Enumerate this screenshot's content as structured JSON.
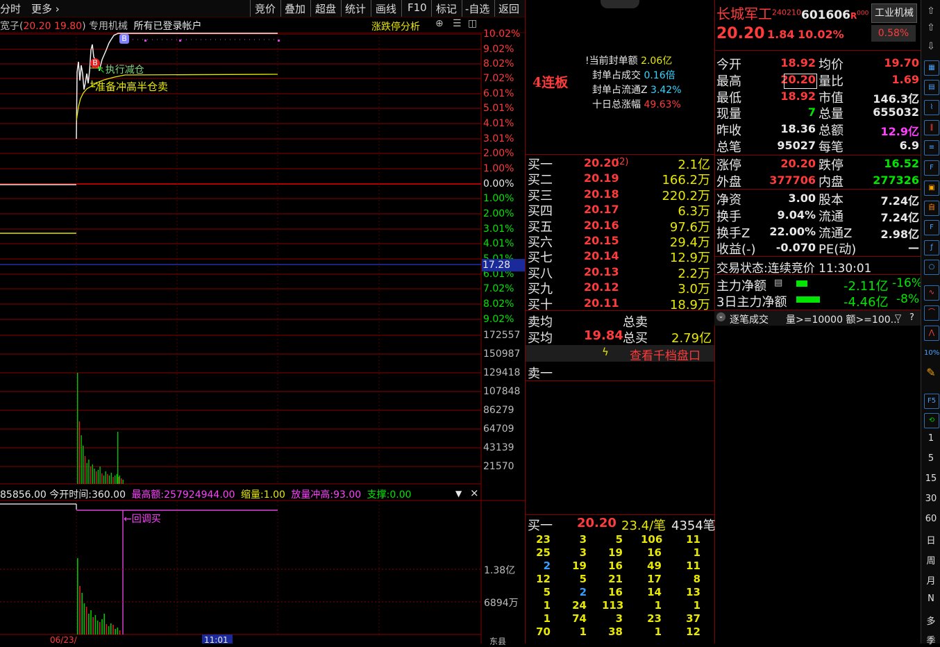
{
  "toolbar": {
    "left_tab": "分时",
    "more": "更多",
    "buttons": [
      "竞价",
      "叠加",
      "超盘",
      "统计",
      "画线",
      "F10",
      "标记",
      "-自选",
      "返回"
    ]
  },
  "chart_header": {
    "name_prefix": "宽子(",
    "prices": "20.20 19.80",
    "name_suffix": ") 专用机械",
    "account": "所有已登录帐户",
    "analysis_link": "涨跌停分析"
  },
  "price_axis": {
    "upper": [
      "10.02%",
      "9.02%",
      "8.02%",
      "7.02%",
      "6.01%",
      "5.01%",
      "4.01%",
      "3.01%",
      "2.00%",
      "1.00%"
    ],
    "zero": "0.00%",
    "lower": [
      "1.00%",
      "2.00%",
      "3.01%",
      "4.01%",
      "5.01%",
      "6.01%",
      "7.02%",
      "8.02%",
      "9.02%"
    ],
    "cursor_price": "17.28"
  },
  "volume_axis": [
    "172557",
    "150987",
    "129418",
    "107848",
    "86279",
    "64709",
    "43139",
    "21570"
  ],
  "annotations": {
    "sell_note": "执行减仓",
    "plan_note": "准备冲高半仓卖",
    "marker_b": "B",
    "marker_b2": "B",
    "callback_buy": "←回调买"
  },
  "indicator_bar": {
    "lead_value": "85856.00",
    "open_time_label": "今开时间:",
    "open_time_value": "360.00",
    "max_amount_label": "最高额:",
    "max_amount_value": "257924944.00",
    "shrink_label": "缩量:",
    "shrink_value": "1.00",
    "surge_label": "放量冲高:",
    "surge_value": "93.00",
    "support_label": "支撑:",
    "support_value": "0.00",
    "close_icon": "×"
  },
  "amount_axis": [
    "1.38亿",
    "6894万"
  ],
  "time_axis": {
    "date": "06/23/",
    "cursor_time": "11:01",
    "right_label": "东县"
  },
  "board": {
    "limit_label": "4连板",
    "current_seal_label": "当前封单额",
    "current_seal_value": "2.06亿",
    "seal_ratio_label": "封单占成交",
    "seal_ratio_value": "0.16倍",
    "seal_float_label": "封单占流通Z",
    "seal_float_value": "3.42%",
    "ten_day_label": "十日总涨幅",
    "ten_day_value": "49.63%"
  },
  "bids": [
    {
      "label": "买一",
      "price": "20.20",
      "extra": "(2)",
      "vol": "2.1亿"
    },
    {
      "label": "买二",
      "price": "20.19",
      "extra": "",
      "vol": "166.2万"
    },
    {
      "label": "买三",
      "price": "20.18",
      "extra": "",
      "vol": "220.2万"
    },
    {
      "label": "买四",
      "price": "20.17",
      "extra": "",
      "vol": "6.3万"
    },
    {
      "label": "买五",
      "price": "20.16",
      "extra": "",
      "vol": "97.6万"
    },
    {
      "label": "买六",
      "price": "20.15",
      "extra": "",
      "vol": "29.4万"
    },
    {
      "label": "买七",
      "price": "20.14",
      "extra": "",
      "vol": "12.9万"
    },
    {
      "label": "买八",
      "price": "20.13",
      "extra": "",
      "vol": "2.2万"
    },
    {
      "label": "买九",
      "price": "20.12",
      "extra": "",
      "vol": "3.0万"
    },
    {
      "label": "买十",
      "price": "20.11",
      "extra": "",
      "vol": "18.9万"
    }
  ],
  "avg": {
    "sell_avg_label": "卖均",
    "total_sell_label": "总卖",
    "buy_avg_label": "买均",
    "buy_avg_value": "19.84",
    "total_buy_label": "总买",
    "total_buy_value": "2.79亿"
  },
  "depth_link": "查看千档盘口",
  "sell_one": "卖一",
  "queue": {
    "label": "买一",
    "price": "20.20",
    "avg": "23.4/笔",
    "count": "4354笔",
    "rows": [
      [
        "23",
        "3",
        "5",
        "106",
        "11"
      ],
      [
        "25",
        "3",
        "19",
        "16",
        "1"
      ],
      [
        "2",
        "19",
        "16",
        "49",
        "11"
      ],
      [
        "12",
        "5",
        "21",
        "17",
        "8"
      ],
      [
        "5",
        "2",
        "16",
        "14",
        "13"
      ],
      [
        "1",
        "24",
        "113",
        "1",
        "1"
      ],
      [
        "1",
        "74",
        "3",
        "23",
        "37"
      ],
      [
        "70",
        "1",
        "38",
        "1",
        "12"
      ]
    ]
  },
  "stock": {
    "name": "长城军工",
    "sup": "240210",
    "code": "601606",
    "r_tag": "R",
    "r_sup": "000",
    "industry": "工业机械",
    "price": "20.20",
    "change": "1.84",
    "pct": "10.02%",
    "industry_pct": "0.58%"
  },
  "stats": [
    {
      "l": "今开",
      "v": "18.92",
      "l2": "均价",
      "v2": "19.70"
    },
    {
      "l": "最高",
      "v": "20.20",
      "l2": "量比",
      "v2": "1.69"
    },
    {
      "l": "最低",
      "v": "18.92",
      "l2": "市值",
      "v2": "146.3亿"
    },
    {
      "l": "现量",
      "v": "7",
      "l2": "总量",
      "v2": "655032"
    },
    {
      "l": "昨收",
      "v": "18.36",
      "l2": "总额",
      "v2": "12.9亿"
    },
    {
      "l": "总笔",
      "v": "95027",
      "l2": "每笔",
      "v2": "6.9"
    }
  ],
  "stats2": [
    {
      "l": "涨停",
      "v": "20.20",
      "l2": "跌停",
      "v2": "16.52"
    },
    {
      "l": "外盘",
      "v": "377706",
      "l2": "内盘",
      "v2": "277326"
    }
  ],
  "stats3": [
    {
      "l": "净资",
      "v": "3.00",
      "l2": "股本",
      "v2": "7.24亿"
    },
    {
      "l": "换手",
      "v": "9.04%",
      "l2": "流通",
      "v2": "7.24亿"
    },
    {
      "l": "换手Z",
      "v": "22.00%",
      "l2": "流通Z",
      "v2": "2.98亿"
    },
    {
      "l": "收益(-)",
      "v": "-0.070",
      "l2": "PE(动)",
      "v2": "—"
    }
  ],
  "trade_status": {
    "label": "交易状态:",
    "value": "连续竞价",
    "time": "11:30:01"
  },
  "main_force": [
    {
      "label": "主力净额",
      "value": "-2.11亿",
      "pct": "-16%"
    },
    {
      "label": "3日主力净额",
      "value": "-4.46亿",
      "pct": "-8%"
    }
  ],
  "tick_header": {
    "label": "逐笔成交",
    "filter": "量>=10000 额>=100..."
  },
  "side_text": [
    "1",
    "5",
    "15",
    "30",
    "60",
    "日",
    "周",
    "月",
    "N",
    "多",
    "季"
  ],
  "side_icons": [
    "10%",
    "F5"
  ]
}
